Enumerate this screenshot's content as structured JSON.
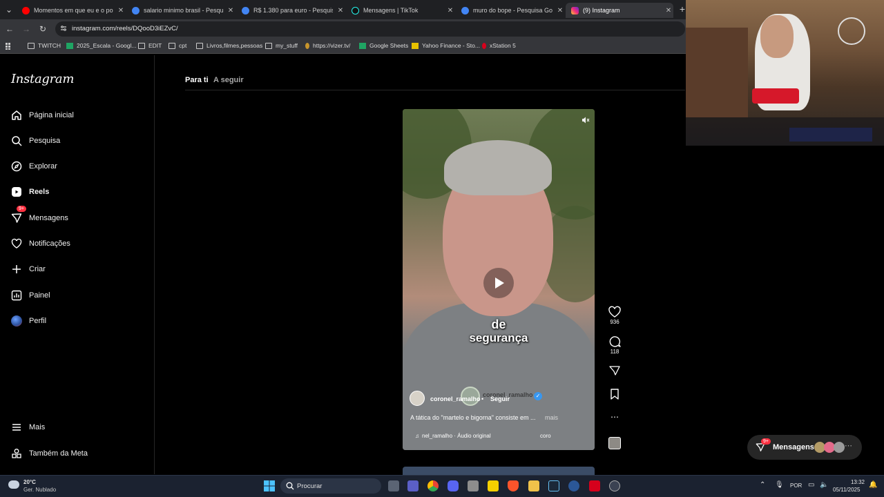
{
  "browser": {
    "tabs": [
      {
        "title": "Momentos em que eu e o poli",
        "favicon_color": "#ff0000"
      },
      {
        "title": "salario minimo brasil - Pesquisa",
        "favicon_color": "#4285f4"
      },
      {
        "title": "R$ 1.380 para euro - Pesquisa",
        "favicon_color": "#4285f4"
      },
      {
        "title": "Mensagens | TikTok",
        "favicon_color": "#111111"
      },
      {
        "title": "muro do bope - Pesquisa Goog",
        "favicon_color": "#4285f4"
      },
      {
        "title": "(9) Instagram",
        "favicon_color": "#e1306c"
      }
    ],
    "new_tab_label": "+",
    "url": "instagram.com/reels/DQooD3iEZvC/",
    "bookmarks": [
      {
        "label": "TWITCH",
        "icon": "folder-icon"
      },
      {
        "label": "2025_Escala - Googl...",
        "icon": "sheets-icon"
      },
      {
        "label": "EDIT",
        "icon": "folder-icon"
      },
      {
        "label": "cpt",
        "icon": "folder-icon"
      },
      {
        "label": "Livros,filmes,pessoas",
        "icon": "folder-icon"
      },
      {
        "label": "my_stuff",
        "icon": "folder-icon"
      },
      {
        "label": "https://vizer.tv/",
        "icon": "site-icon"
      },
      {
        "label": "Google Sheets",
        "icon": "sheets-icon"
      },
      {
        "label": "Yahoo Finance - Sto...",
        "icon": "site-icon"
      },
      {
        "label": "xStation 5",
        "icon": "site-icon"
      }
    ]
  },
  "instagram": {
    "logo": "Instagram",
    "nav": [
      {
        "label": "Página inicial",
        "icon": "home-icon"
      },
      {
        "label": "Pesquisa",
        "icon": "search-icon"
      },
      {
        "label": "Explorar",
        "icon": "compass-icon"
      },
      {
        "label": "Reels",
        "icon": "reels-icon"
      },
      {
        "label": "Mensagens",
        "icon": "messenger-icon",
        "badge": "9+"
      },
      {
        "label": "Notificações",
        "icon": "heart-icon"
      },
      {
        "label": "Criar",
        "icon": "plus-icon"
      },
      {
        "label": "Painel",
        "icon": "dashboard-icon"
      },
      {
        "label": "Perfil",
        "icon": "avatar-icon"
      }
    ],
    "nav_bottom": [
      {
        "label": "Mais",
        "icon": "menu-icon"
      },
      {
        "label": "Também da Meta",
        "icon": "meta-icon"
      }
    ],
    "feed_tabs": {
      "for_you": "Para ti",
      "following": "A seguir"
    },
    "reel": {
      "caption_word_1": "de",
      "caption_word_2": "segurança",
      "overlay_handle": "coronel_ramalho",
      "username": "coronel_ramalho",
      "follow": "Seguir",
      "description": "A tática do \"martelo e bigorna\" consiste em ...",
      "more": "mais",
      "audio": "nel_ramalho · Áudio original",
      "audio_trail": "coro",
      "likes": "936",
      "comments": "118"
    },
    "messages_pill": {
      "label": "Mensagens",
      "badge": "9+"
    }
  },
  "taskbar": {
    "weather_temp": "20°C",
    "weather_desc": "Ger. Nublado",
    "search_placeholder": "Procurar",
    "language": "POR",
    "time": "13:32",
    "date": "05/11/2025"
  }
}
